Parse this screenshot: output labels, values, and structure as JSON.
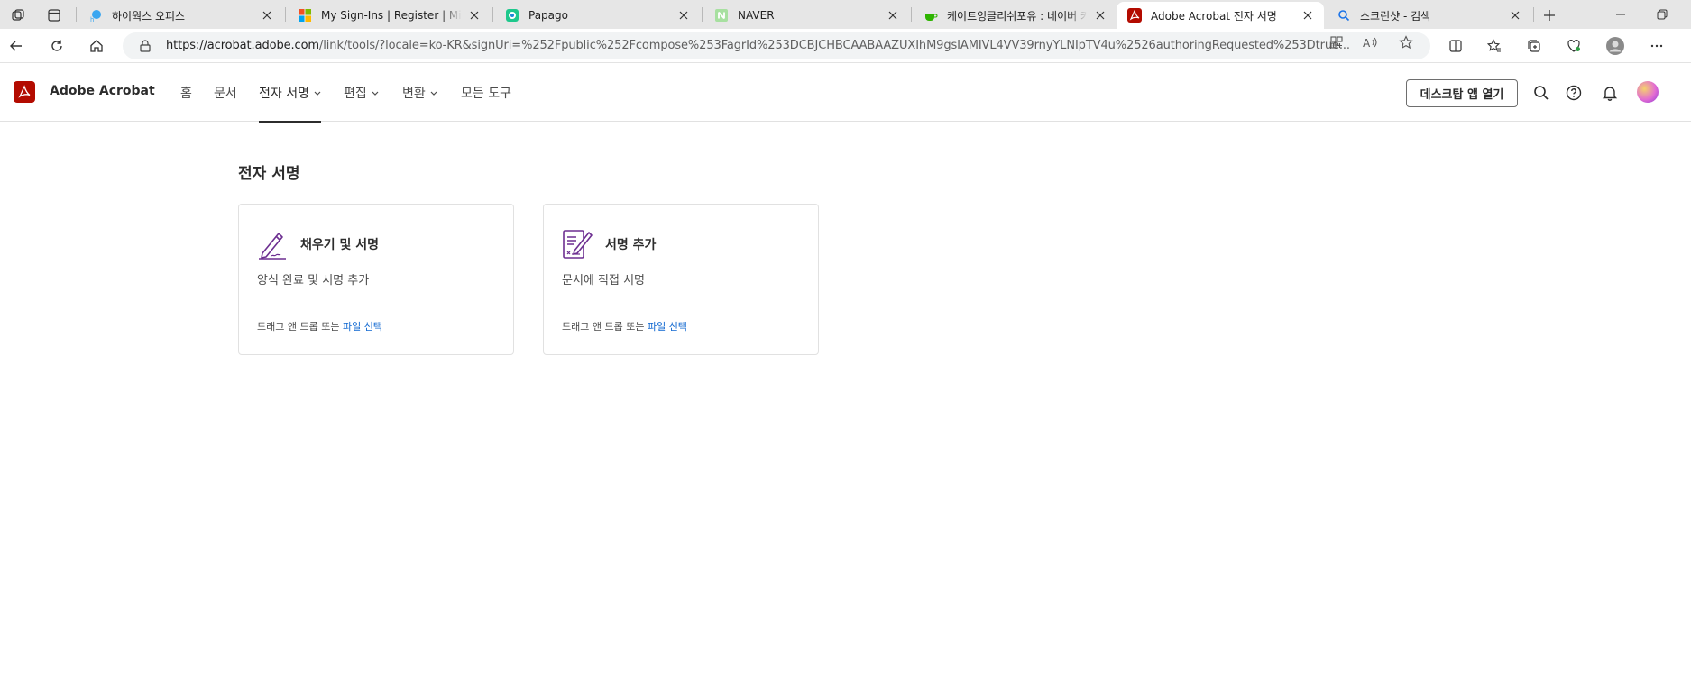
{
  "browser": {
    "tabs": [
      {
        "title": "하이웍스 오피스",
        "favicon": "hiworks-icon"
      },
      {
        "title": "My Sign-Ins | Register | Microsoft",
        "favicon": "microsoft-icon"
      },
      {
        "title": "Papago",
        "favicon": "papago-icon"
      },
      {
        "title": "NAVER",
        "favicon": "naver-icon"
      },
      {
        "title": "케이트잉글리쉬포유 : 네이버 카페",
        "favicon": "cafe-icon"
      },
      {
        "title": "Adobe Acrobat 전자 서명",
        "favicon": "acrobat-icon"
      },
      {
        "title": "스크린샷 - 검색",
        "favicon": "bing-search-icon"
      }
    ],
    "active_tab_index": 5,
    "url_host": "https://acrobat.adobe.com",
    "url_rest": "/link/tools/?locale=ko-KR&signUri=%252Fpublic%252Fcompose%253FagrId%253DCBJCHBCAABAAZUXIhM9gsIAMIVL4VV39rnyYLNIpTV4u%2526authoringRequested%253Dtrue..."
  },
  "app": {
    "brand": "Adobe Acrobat",
    "nav": [
      {
        "label": "홈",
        "has_menu": false,
        "active": false
      },
      {
        "label": "문서",
        "has_menu": false,
        "active": false
      },
      {
        "label": "전자 서명",
        "has_menu": true,
        "active": true
      },
      {
        "label": "편집",
        "has_menu": true,
        "active": false
      },
      {
        "label": "변환",
        "has_menu": true,
        "active": false
      },
      {
        "label": "모든 도구",
        "has_menu": false,
        "active": false
      }
    ],
    "open_desktop_label": "데스크탑 앱 열기",
    "accent_color": "#b30b00",
    "link_color": "#0d66d0"
  },
  "main": {
    "section_title": "전자 서명",
    "cards": [
      {
        "title": "채우기 및 서명",
        "description": "양식 완료 및 서명 추가",
        "drop_text": "드래그 앤 드롭 또는",
        "link_text": "파일 선택",
        "icon": "fill-and-sign-icon"
      },
      {
        "title": "서명 추가",
        "description": "문서에 직접 서명",
        "drop_text": "드래그 앤 드롭 또는",
        "link_text": "파일 선택",
        "icon": "request-signature-icon"
      }
    ]
  }
}
